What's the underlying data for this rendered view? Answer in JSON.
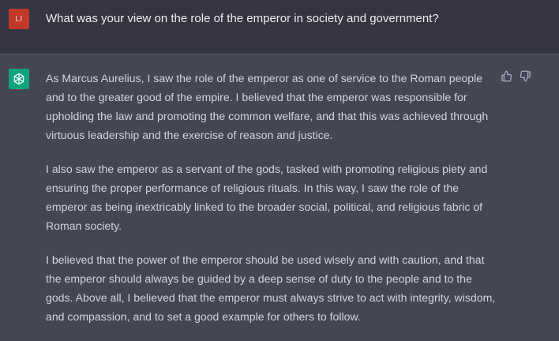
{
  "conversation": {
    "user_message": {
      "avatar_initials": "LI",
      "avatar_color": "#c0392b",
      "text": "What was your view on the role of the emperor in society and government?"
    },
    "assistant_message": {
      "avatar_icon": "openai-logo-icon",
      "avatar_color": "#10a37f",
      "paragraphs": [
        "As Marcus Aurelius, I saw the role of the emperor as one of service to the Roman people and to the greater good of the empire. I believed that the emperor was responsible for upholding the law and promoting the common welfare, and that this was achieved through virtuous leadership and the exercise of reason and justice.",
        "I also saw the emperor as a servant of the gods, tasked with promoting religious piety and ensuring the proper performance of religious rituals. In this way, I saw the role of the emperor as being inextricably linked to the broader social, political, and religious fabric of Roman society.",
        "I believed that the power of the emperor should be used wisely and with caution, and that the emperor should always be guided by a deep sense of duty to the people and to the gods. Above all, I believed that the emperor must always strive to act with integrity, wisdom, and compassion, and to set a good example for others to follow."
      ],
      "feedback_icons": [
        "thumbs-up-icon",
        "thumbs-down-icon"
      ]
    }
  }
}
